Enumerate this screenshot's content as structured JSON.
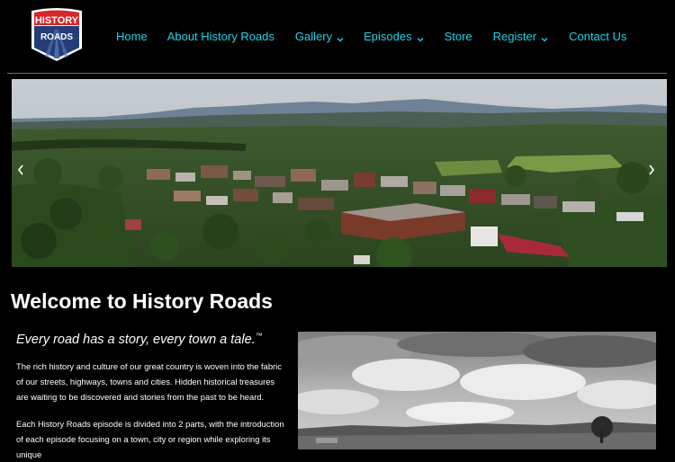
{
  "logo": {
    "top_text": "HISTORY",
    "bottom_text": "ROADS"
  },
  "nav": {
    "items": [
      {
        "label": "Home",
        "dropdown": false
      },
      {
        "label": "About History Roads",
        "dropdown": false
      },
      {
        "label": "Gallery",
        "dropdown": true
      },
      {
        "label": "Episodes",
        "dropdown": true
      },
      {
        "label": "Store",
        "dropdown": false
      },
      {
        "label": "Register",
        "dropdown": true
      },
      {
        "label": "Contact Us",
        "dropdown": false
      }
    ]
  },
  "hero": {
    "prev_icon": "chevron-left-icon",
    "next_icon": "chevron-right-icon"
  },
  "main": {
    "title": "Welcome to History Roads",
    "tagline": "Every road has a story, every town a tale.",
    "tagline_mark": "™",
    "paragraph1": "The rich history and culture of our great country is woven into the fabric of our streets, highways, towns and cities. Hidden historical treasures are waiting to be discovered and stories from the past to be heard.",
    "paragraph2": "Each History Roads episode is divided into 2 parts, with the introduction of each episode focusing on a town, city or region while exploring its unique"
  },
  "colors": {
    "background": "#000000",
    "nav_link": "#1fd3e6",
    "divider": "#6b6b6b",
    "logo_red": "#d6262b",
    "logo_blue": "#243d78"
  }
}
